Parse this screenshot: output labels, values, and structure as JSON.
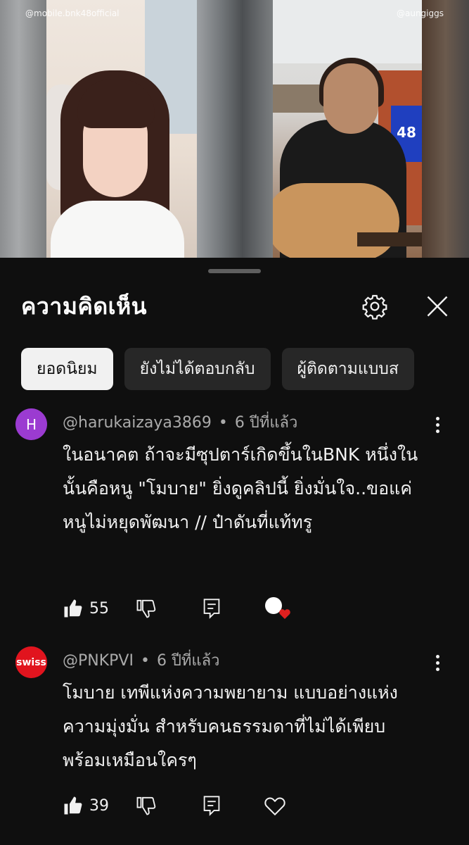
{
  "video": {
    "watermark_left": "@mobile.bnk48official",
    "watermark_right": "@aungiggs",
    "jersey_number": "48"
  },
  "sheet": {
    "title": "ความคิดเห็น",
    "chips": [
      {
        "label": "ยอดนิยม",
        "active": true
      },
      {
        "label": "ยังไม่ได้ตอบกลับ",
        "active": false
      },
      {
        "label": "ผู้ติดตามแบบส",
        "active": false
      }
    ]
  },
  "comments": [
    {
      "avatar_letter": "H",
      "avatar_color": "#9b3bd1",
      "author": "@harukaizaya3869",
      "time": "6 ปีที่แล้ว",
      "text": "ในอนาคต ถ้าจะมีซุปตาร์เกิดขึ้นในBNK หนึ่งในนั้นคือหนู \"โมบาย\" ยิ่งดูคลิปนี้ ยิ่งมั่นใจ..ขอแค่หนูไม่หยุดพัฒนา // ป๋าดันที่แท้ทรู",
      "likes": "55",
      "creator_heart": true
    },
    {
      "avatar_letter": "swiss",
      "avatar_color": "#e1141e",
      "author": "@PNKPVI",
      "time": "6 ปีที่แล้ว",
      "text": "โมบาย เทพีแห่งความพยายาม แบบอย่างแห่งความมุ่งมั่น สำหรับคนธรรมดาที่ไม่ได้เพียบพร้อมเหมือนใครๆ",
      "likes": "39",
      "creator_heart": false
    }
  ],
  "icons": {
    "settings": "gear-icon",
    "close": "close-icon",
    "like": "thumbs-up-icon",
    "dislike": "thumbs-down-icon",
    "reply": "reply-icon",
    "heart": "heart-icon",
    "more": "more-vertical-icon"
  }
}
